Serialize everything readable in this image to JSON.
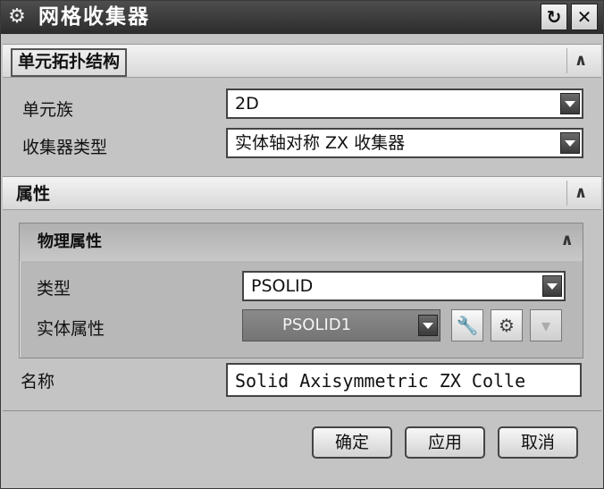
{
  "window": {
    "title": "网格收集器",
    "title_icon": "gear-icon",
    "reset_icon": "reset-icon",
    "close_icon": "close-icon"
  },
  "sections": {
    "topology": {
      "title": "单元拓扑结构",
      "element_family": {
        "label": "单元族",
        "value": "2D"
      },
      "collector_type": {
        "label": "收集器类型",
        "value": "实体轴对称 ZX 收集器"
      }
    },
    "properties": {
      "title": "属性",
      "physical": {
        "title": "物理属性",
        "type": {
          "label": "类型",
          "value": "PSOLID"
        },
        "solid_property": {
          "label": "实体属性",
          "value": "PSOLID1"
        }
      }
    }
  },
  "name_field": {
    "label": "名称",
    "value": "Solid Axisymmetric ZX Colle"
  },
  "footer": {
    "ok": "确定",
    "apply": "应用",
    "cancel": "取消"
  },
  "icons": {
    "collapse": "chevron-up-icon",
    "edit": "wrench-icon",
    "create": "create-modeling-object-icon",
    "more": "chevron-down-icon"
  }
}
